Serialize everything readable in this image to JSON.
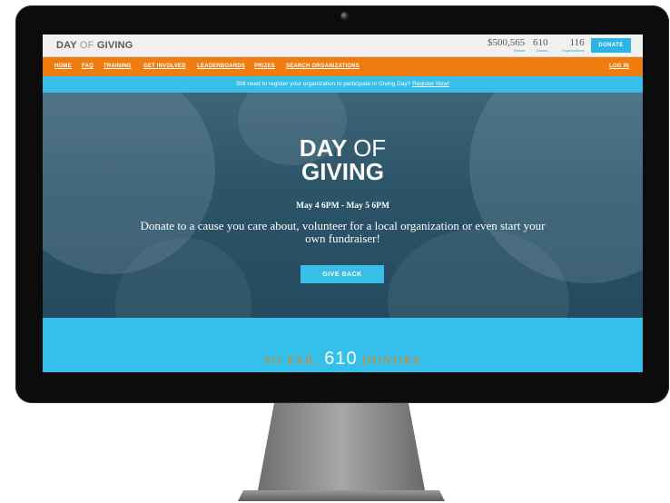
{
  "brand": {
    "logo_dark_1": "DAY",
    "logo_light": "OF",
    "logo_dark_2": "GIVING"
  },
  "stats": [
    {
      "value": "$500,565",
      "label": "Raised"
    },
    {
      "value": "610",
      "label": "Donors"
    },
    {
      "value": "116",
      "label": "Organizations"
    }
  ],
  "header": {
    "donate_label": "DONATE"
  },
  "nav": {
    "items": [
      "HOME",
      "FAQ",
      "TRAINING",
      "GET INVOLVED",
      "LEADERBOARDS",
      "PRIZES",
      "SEARCH ORGANIZATIONS"
    ],
    "login_label": "LOG IN"
  },
  "announcement": {
    "text": "Still need to register your organization to participate in Giving Day?",
    "link_text": "Register Now!"
  },
  "hero": {
    "title_line1_bold": "DAY",
    "title_line1_light": "OF",
    "title_line2": "GIVING",
    "date_range": "May 4 6PM - May 5 6PM",
    "tagline": "Donate to a cause you care about, volunteer for a local organization or even start your own fundraiser!",
    "cta_label": "GIVE BACK"
  },
  "counter": {
    "prefix": "SO FAR,",
    "number": "610",
    "suffix": "DONORS"
  },
  "colors": {
    "accent_blue": "#37bfe9",
    "accent_orange": "#ef7c0f",
    "hero_overlay": "#2c5468"
  }
}
